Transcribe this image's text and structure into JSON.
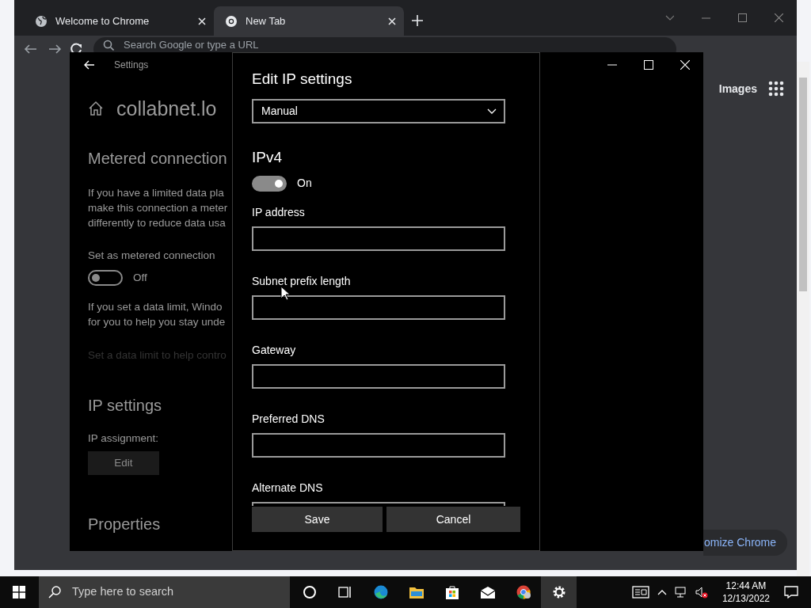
{
  "browser": {
    "tabs": [
      {
        "label": "Welcome to Chrome",
        "selected": false
      },
      {
        "label": "New Tab",
        "selected": true
      }
    ],
    "omnibox": {
      "placeholder": "Search Google or type a URL"
    },
    "page": {
      "images_link": "Images",
      "customize_button": "omize Chrome"
    }
  },
  "settings": {
    "title": "Settings",
    "items": [
      {
        "kind": "page_title",
        "text": "collabnet.lo"
      },
      {
        "kind": "heading",
        "text": "Metered connection"
      },
      {
        "kind": "paragraph",
        "lines": [
          "If you have a limited data pla",
          "make this connection a meter",
          "differently to reduce data usa"
        ]
      },
      {
        "kind": "label",
        "text": "Set as metered connection"
      },
      {
        "kind": "toggle",
        "on": false,
        "text": "Off"
      },
      {
        "kind": "paragraph",
        "lines": [
          "If you set a data limit, Windo",
          "for you to help you stay unde"
        ]
      },
      {
        "kind": "dim_text",
        "text": "Set a data limit to help contro"
      },
      {
        "kind": "heading",
        "text": "IP settings"
      },
      {
        "kind": "label",
        "text": "IP assignment:"
      },
      {
        "kind": "button",
        "text": "Edit"
      },
      {
        "kind": "heading",
        "text": "Properties"
      }
    ]
  },
  "dialog": {
    "title": "Edit IP settings",
    "mode": "Manual",
    "section": "IPv4",
    "toggle": {
      "on": true,
      "text": "On"
    },
    "fields": [
      {
        "label": "IP address"
      },
      {
        "label": "Subnet prefix length"
      },
      {
        "label": "Gateway"
      },
      {
        "label": "Preferred DNS"
      },
      {
        "label": "Alternate DNS"
      }
    ],
    "buttons": [
      "Save",
      "Cancel"
    ]
  },
  "taskbar": {
    "search_placeholder": "Type here to search",
    "apps": [
      {
        "kind": "cortana",
        "selected": false
      },
      {
        "kind": "task_view",
        "selected": false
      },
      {
        "kind": "edge",
        "selected": false
      },
      {
        "kind": "explorer",
        "selected": false
      },
      {
        "kind": "store",
        "selected": false
      },
      {
        "kind": "mail",
        "selected": false
      },
      {
        "kind": "chrome",
        "selected": false
      },
      {
        "kind": "settings",
        "selected": true
      }
    ],
    "time": "12:44 AM",
    "date": "12/13/2022"
  }
}
